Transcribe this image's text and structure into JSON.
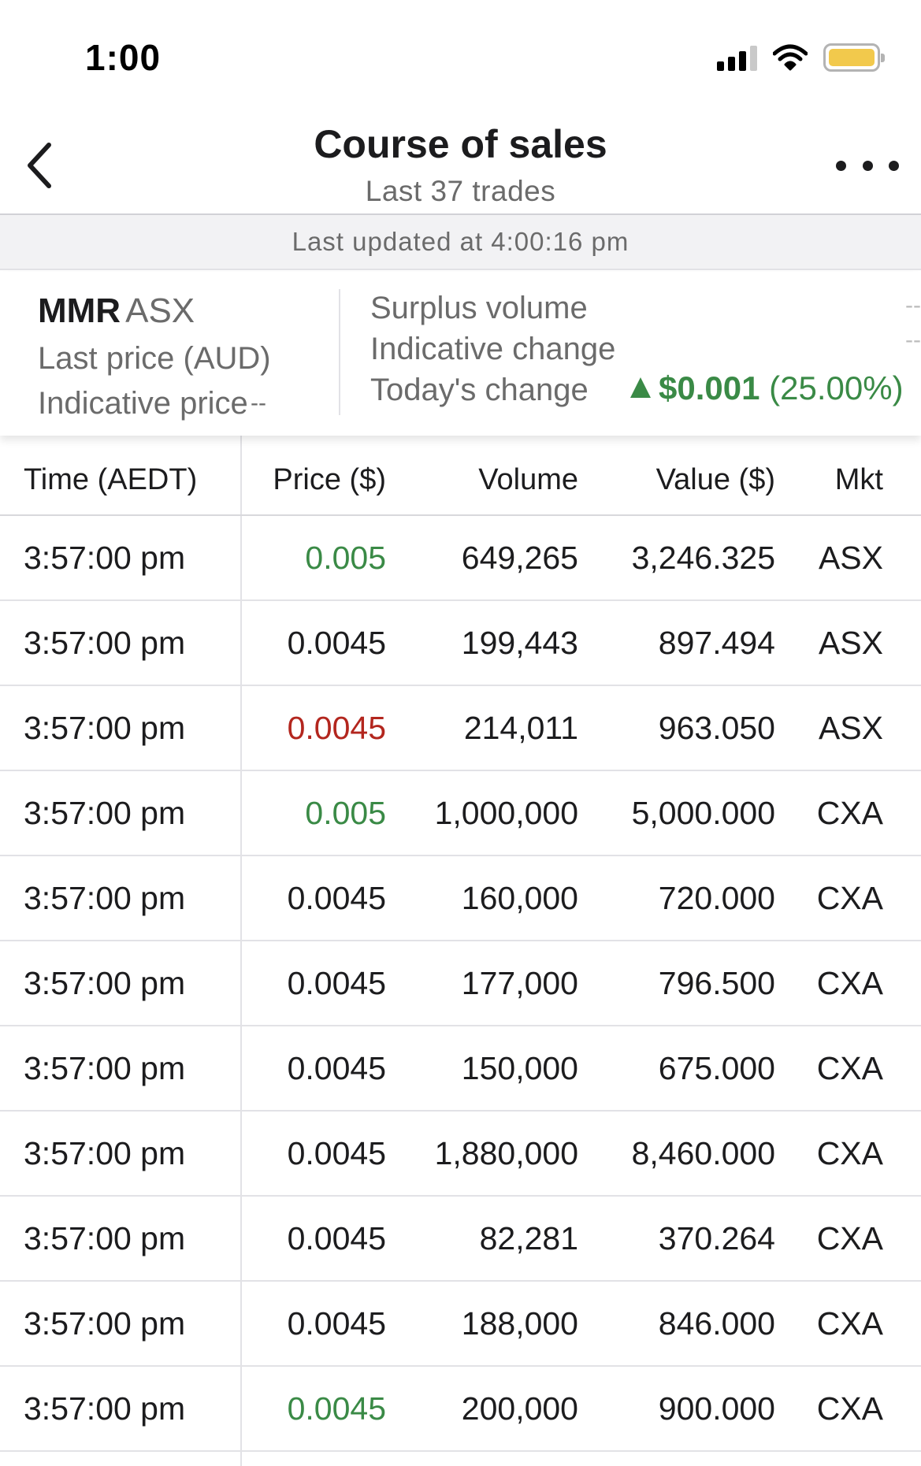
{
  "status_bar": {
    "time": "1:00"
  },
  "nav": {
    "title": "Course of sales",
    "subtitle": "Last 37 trades"
  },
  "updated": "Last updated at 4:00:16 pm",
  "summary": {
    "ticker": "MMR",
    "exchange": "ASX",
    "last_price_label": "Last price (AUD)",
    "indicative_price_label": "Indicative price",
    "indicative_price_value": "--",
    "surplus_volume_label": "Surplus volume",
    "surplus_volume_value": "--",
    "indicative_change_label": "Indicative change",
    "indicative_change_value": "--",
    "todays_change_label": "Today's change",
    "todays_change_abs": "$0.001",
    "todays_change_pct": "(25.00%)"
  },
  "table": {
    "headers": [
      "Time (AEDT)",
      "Price ($)",
      "Volume",
      "Value ($)",
      "Mkt"
    ],
    "rows": [
      {
        "time": "3:57:00 pm",
        "price": "0.005",
        "price_color": "green",
        "volume": "649,265",
        "value": "3,246.325",
        "mkt": "ASX"
      },
      {
        "time": "3:57:00 pm",
        "price": "0.0045",
        "price_color": "plain",
        "volume": "199,443",
        "value": "897.494",
        "mkt": "ASX"
      },
      {
        "time": "3:57:00 pm",
        "price": "0.0045",
        "price_color": "red",
        "volume": "214,011",
        "value": "963.050",
        "mkt": "ASX"
      },
      {
        "time": "3:57:00 pm",
        "price": "0.005",
        "price_color": "green",
        "volume": "1,000,000",
        "value": "5,000.000",
        "mkt": "CXA"
      },
      {
        "time": "3:57:00 pm",
        "price": "0.0045",
        "price_color": "plain",
        "volume": "160,000",
        "value": "720.000",
        "mkt": "CXA"
      },
      {
        "time": "3:57:00 pm",
        "price": "0.0045",
        "price_color": "plain",
        "volume": "177,000",
        "value": "796.500",
        "mkt": "CXA"
      },
      {
        "time": "3:57:00 pm",
        "price": "0.0045",
        "price_color": "plain",
        "volume": "150,000",
        "value": "675.000",
        "mkt": "CXA"
      },
      {
        "time": "3:57:00 pm",
        "price": "0.0045",
        "price_color": "plain",
        "volume": "1,880,000",
        "value": "8,460.000",
        "mkt": "CXA"
      },
      {
        "time": "3:57:00 pm",
        "price": "0.0045",
        "price_color": "plain",
        "volume": "82,281",
        "value": "370.264",
        "mkt": "CXA"
      },
      {
        "time": "3:57:00 pm",
        "price": "0.0045",
        "price_color": "plain",
        "volume": "188,000",
        "value": "846.000",
        "mkt": "CXA"
      },
      {
        "time": "3:57:00 pm",
        "price": "0.0045",
        "price_color": "green",
        "volume": "200,000",
        "value": "900.000",
        "mkt": "CXA"
      }
    ]
  },
  "colors": {
    "up": "#3a8a46",
    "down": "#b3261e",
    "battery": "#f2c94c"
  },
  "icons": [
    "signal-icon",
    "wifi-icon",
    "battery-icon",
    "back-chevron-icon",
    "more-icon",
    "up-arrow-icon"
  ]
}
